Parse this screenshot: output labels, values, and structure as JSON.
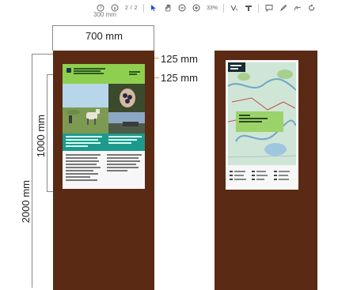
{
  "toolbar": {
    "page_indicator": "2 / 2",
    "zoom_level": "33%",
    "icons": [
      "help-icon",
      "info-icon",
      "pointer-icon",
      "hand-icon",
      "zoom-out-icon",
      "zoom-in-icon",
      "text-select-icon",
      "highlight-icon",
      "comment-icon",
      "pen-icon",
      "sign-icon",
      "rotate-icon"
    ]
  },
  "clipped_top_label": "300 mm",
  "dimensions": {
    "panel_width": "700 mm",
    "top_margin": "125 mm",
    "side_margin": "125 mm",
    "panel_height": "1000 mm",
    "post_height": "2000 mm"
  },
  "colors": {
    "post": "#5a2a14",
    "poster_green": "#8fcf4f",
    "poster_teal": "#1d9a8b"
  }
}
